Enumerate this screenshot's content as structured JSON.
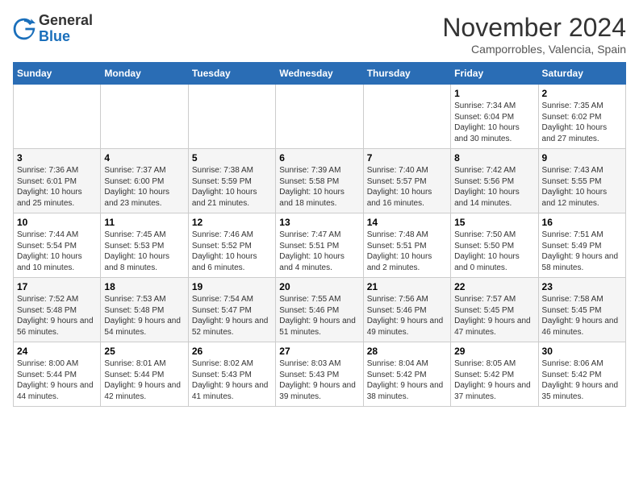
{
  "header": {
    "logo_general": "General",
    "logo_blue": "Blue",
    "month_title": "November 2024",
    "location": "Camporrobles, Valencia, Spain"
  },
  "days_of_week": [
    "Sunday",
    "Monday",
    "Tuesday",
    "Wednesday",
    "Thursday",
    "Friday",
    "Saturday"
  ],
  "weeks": [
    [
      {
        "day": "",
        "text": ""
      },
      {
        "day": "",
        "text": ""
      },
      {
        "day": "",
        "text": ""
      },
      {
        "day": "",
        "text": ""
      },
      {
        "day": "",
        "text": ""
      },
      {
        "day": "1",
        "text": "Sunrise: 7:34 AM\nSunset: 6:04 PM\nDaylight: 10 hours and 30 minutes."
      },
      {
        "day": "2",
        "text": "Sunrise: 7:35 AM\nSunset: 6:02 PM\nDaylight: 10 hours and 27 minutes."
      }
    ],
    [
      {
        "day": "3",
        "text": "Sunrise: 7:36 AM\nSunset: 6:01 PM\nDaylight: 10 hours and 25 minutes."
      },
      {
        "day": "4",
        "text": "Sunrise: 7:37 AM\nSunset: 6:00 PM\nDaylight: 10 hours and 23 minutes."
      },
      {
        "day": "5",
        "text": "Sunrise: 7:38 AM\nSunset: 5:59 PM\nDaylight: 10 hours and 21 minutes."
      },
      {
        "day": "6",
        "text": "Sunrise: 7:39 AM\nSunset: 5:58 PM\nDaylight: 10 hours and 18 minutes."
      },
      {
        "day": "7",
        "text": "Sunrise: 7:40 AM\nSunset: 5:57 PM\nDaylight: 10 hours and 16 minutes."
      },
      {
        "day": "8",
        "text": "Sunrise: 7:42 AM\nSunset: 5:56 PM\nDaylight: 10 hours and 14 minutes."
      },
      {
        "day": "9",
        "text": "Sunrise: 7:43 AM\nSunset: 5:55 PM\nDaylight: 10 hours and 12 minutes."
      }
    ],
    [
      {
        "day": "10",
        "text": "Sunrise: 7:44 AM\nSunset: 5:54 PM\nDaylight: 10 hours and 10 minutes."
      },
      {
        "day": "11",
        "text": "Sunrise: 7:45 AM\nSunset: 5:53 PM\nDaylight: 10 hours and 8 minutes."
      },
      {
        "day": "12",
        "text": "Sunrise: 7:46 AM\nSunset: 5:52 PM\nDaylight: 10 hours and 6 minutes."
      },
      {
        "day": "13",
        "text": "Sunrise: 7:47 AM\nSunset: 5:51 PM\nDaylight: 10 hours and 4 minutes."
      },
      {
        "day": "14",
        "text": "Sunrise: 7:48 AM\nSunset: 5:51 PM\nDaylight: 10 hours and 2 minutes."
      },
      {
        "day": "15",
        "text": "Sunrise: 7:50 AM\nSunset: 5:50 PM\nDaylight: 10 hours and 0 minutes."
      },
      {
        "day": "16",
        "text": "Sunrise: 7:51 AM\nSunset: 5:49 PM\nDaylight: 9 hours and 58 minutes."
      }
    ],
    [
      {
        "day": "17",
        "text": "Sunrise: 7:52 AM\nSunset: 5:48 PM\nDaylight: 9 hours and 56 minutes."
      },
      {
        "day": "18",
        "text": "Sunrise: 7:53 AM\nSunset: 5:48 PM\nDaylight: 9 hours and 54 minutes."
      },
      {
        "day": "19",
        "text": "Sunrise: 7:54 AM\nSunset: 5:47 PM\nDaylight: 9 hours and 52 minutes."
      },
      {
        "day": "20",
        "text": "Sunrise: 7:55 AM\nSunset: 5:46 PM\nDaylight: 9 hours and 51 minutes."
      },
      {
        "day": "21",
        "text": "Sunrise: 7:56 AM\nSunset: 5:46 PM\nDaylight: 9 hours and 49 minutes."
      },
      {
        "day": "22",
        "text": "Sunrise: 7:57 AM\nSunset: 5:45 PM\nDaylight: 9 hours and 47 minutes."
      },
      {
        "day": "23",
        "text": "Sunrise: 7:58 AM\nSunset: 5:45 PM\nDaylight: 9 hours and 46 minutes."
      }
    ],
    [
      {
        "day": "24",
        "text": "Sunrise: 8:00 AM\nSunset: 5:44 PM\nDaylight: 9 hours and 44 minutes."
      },
      {
        "day": "25",
        "text": "Sunrise: 8:01 AM\nSunset: 5:44 PM\nDaylight: 9 hours and 42 minutes."
      },
      {
        "day": "26",
        "text": "Sunrise: 8:02 AM\nSunset: 5:43 PM\nDaylight: 9 hours and 41 minutes."
      },
      {
        "day": "27",
        "text": "Sunrise: 8:03 AM\nSunset: 5:43 PM\nDaylight: 9 hours and 39 minutes."
      },
      {
        "day": "28",
        "text": "Sunrise: 8:04 AM\nSunset: 5:42 PM\nDaylight: 9 hours and 38 minutes."
      },
      {
        "day": "29",
        "text": "Sunrise: 8:05 AM\nSunset: 5:42 PM\nDaylight: 9 hours and 37 minutes."
      },
      {
        "day": "30",
        "text": "Sunrise: 8:06 AM\nSunset: 5:42 PM\nDaylight: 9 hours and 35 minutes."
      }
    ]
  ]
}
